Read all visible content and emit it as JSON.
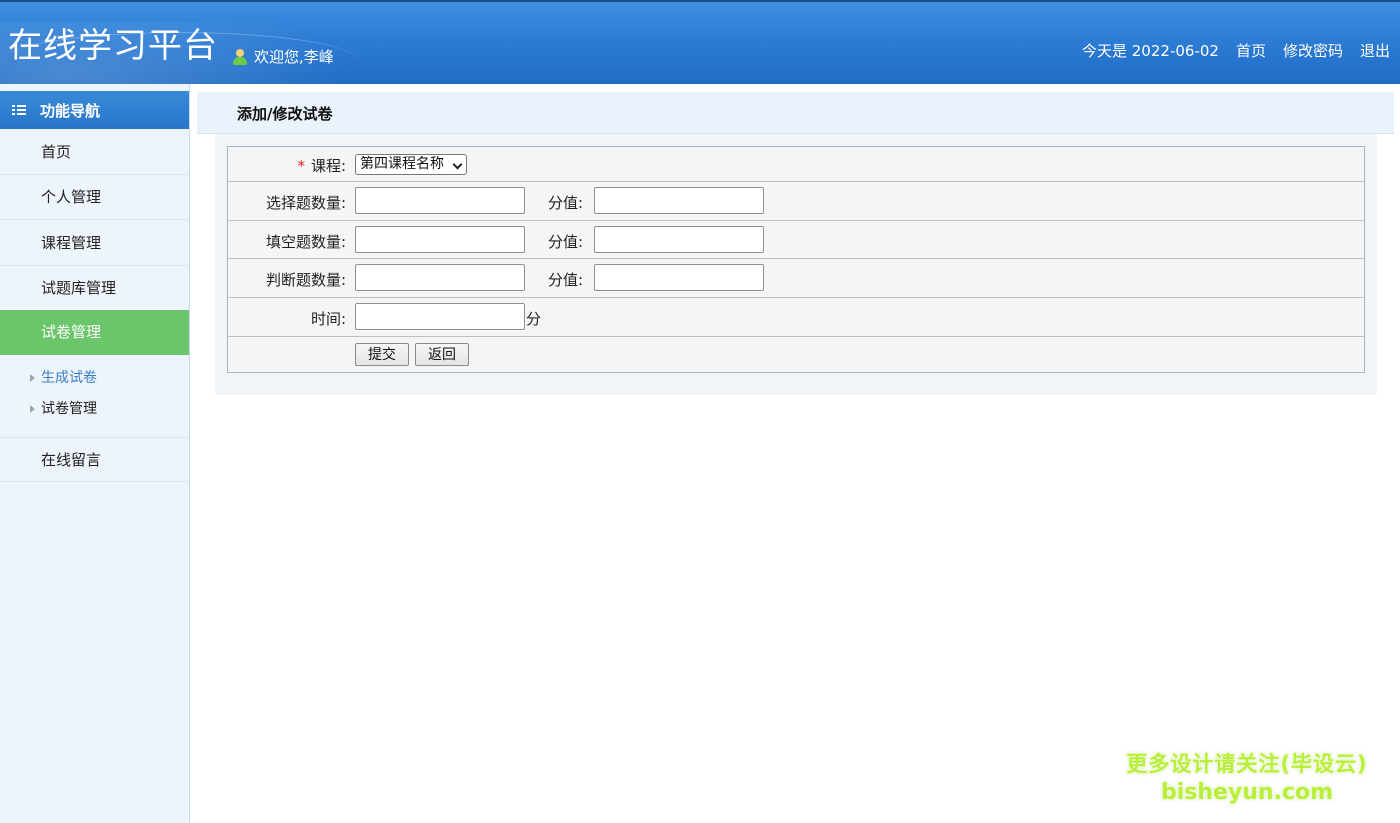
{
  "header": {
    "title": "在线学习平台",
    "welcome": "欢迎您,李峰",
    "date": "今天是 2022-06-02",
    "links": [
      "首页",
      "修改密码",
      "退出"
    ]
  },
  "sidebar": {
    "heading": "功能导航",
    "items": [
      {
        "label": "首页"
      },
      {
        "label": "个人管理"
      },
      {
        "label": "课程管理"
      },
      {
        "label": "试题库管理"
      },
      {
        "label": "试卷管理",
        "active": true
      }
    ],
    "sub_items": [
      {
        "label": "生成试卷",
        "current": true
      },
      {
        "label": "试卷管理"
      }
    ],
    "after_items": [
      {
        "label": "在线留言"
      }
    ]
  },
  "content": {
    "title": "添加/修改试卷",
    "form": {
      "required_mark": "*",
      "course_label": "课程:",
      "course_selected": "第四课程名称",
      "choice_count_label": "选择题数量:",
      "fill_count_label": "填空题数量:",
      "judge_count_label": "判断题数量:",
      "score_label": "分值:",
      "time_label": "时间:",
      "time_unit": "分",
      "choice_count_value": "",
      "choice_score_value": "",
      "fill_count_value": "",
      "fill_score_value": "",
      "judge_count_value": "",
      "judge_score_value": "",
      "time_value": "",
      "submit_label": "提交",
      "back_label": "返回"
    }
  },
  "watermark": {
    "line1": "更多设计请关注(毕设云)",
    "line2": "bisheyun.com"
  },
  "colors": {
    "header_blue": "#2a79d2",
    "nav_active_green": "#6ac56b",
    "sidebar_bg": "#edf4fb",
    "required_red": "#e02020",
    "sub_item_current": "#3d7fc4"
  }
}
